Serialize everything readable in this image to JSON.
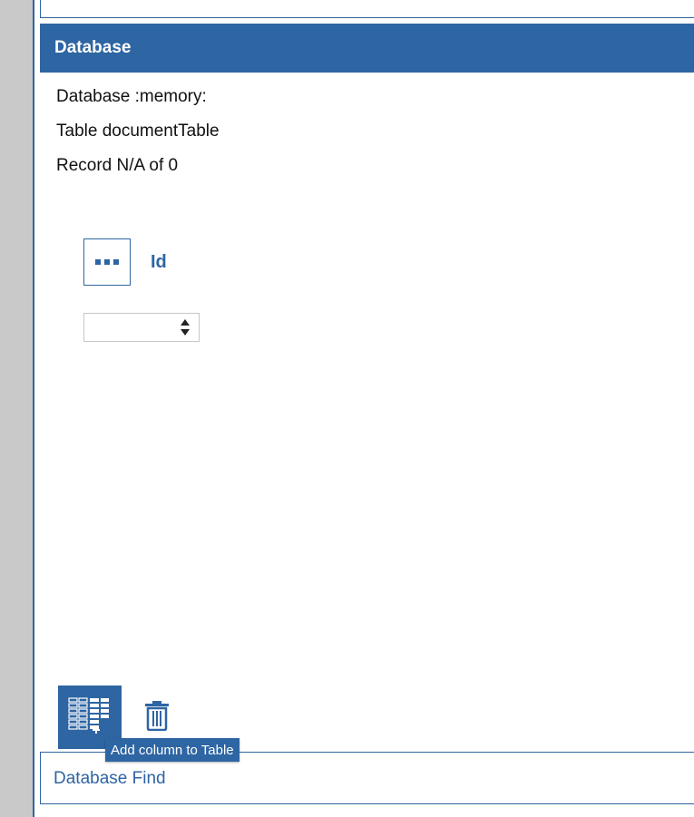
{
  "database_panel": {
    "title": "Database",
    "database_line": "Database :memory:",
    "table_line": "Table documentTable",
    "record_line": "Record N/A of 0"
  },
  "field": {
    "label": "Id",
    "value": ""
  },
  "toolbar": {
    "add_column_icon": "add-column-table-icon",
    "delete_icon": "trash-icon",
    "tooltip": "Add column to Table"
  },
  "find_panel": {
    "title": "Database Find"
  },
  "colors": {
    "accent": "#2e65a3",
    "gutter": "#c9c9c9",
    "text": "#111111"
  }
}
